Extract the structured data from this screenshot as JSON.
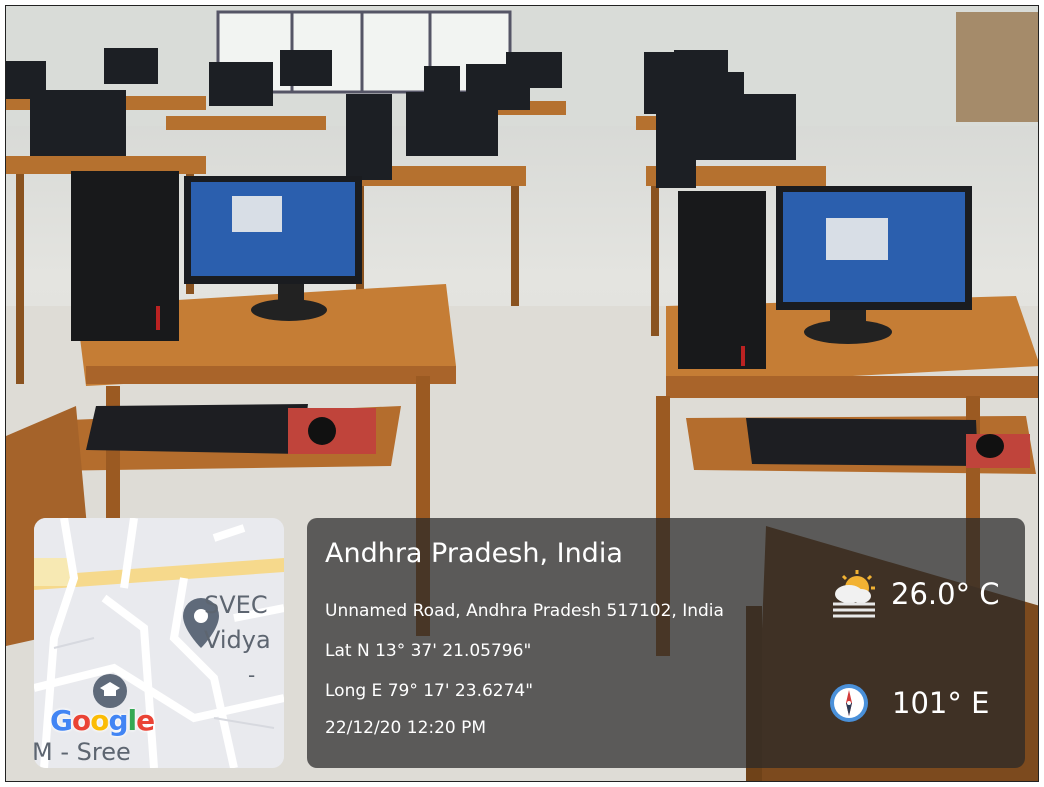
{
  "map": {
    "poi_line1": "SVEC",
    "poi_line2": "Vidya",
    "poi_dash": "-",
    "bottom_label": "M - Sree",
    "logo": {
      "g1": "G",
      "g2": "o",
      "g3": "o",
      "g4": "g",
      "g5": "l",
      "g6": "e"
    }
  },
  "info": {
    "location_title": "Andhra Pradesh, India",
    "address": "Unnamed Road, Andhra Pradesh 517102, India",
    "latitude": "Lat N 13° 37' 21.05796\"",
    "longitude": "Long E 79° 17' 23.6274\"",
    "datetime": "22/12/20 12:20 PM",
    "temperature": "26.0° C",
    "heading": "101° E"
  },
  "icons": [
    "map-pin-icon",
    "graduation-cap-icon",
    "weather-cloud-sun-icon",
    "compass-icon"
  ]
}
